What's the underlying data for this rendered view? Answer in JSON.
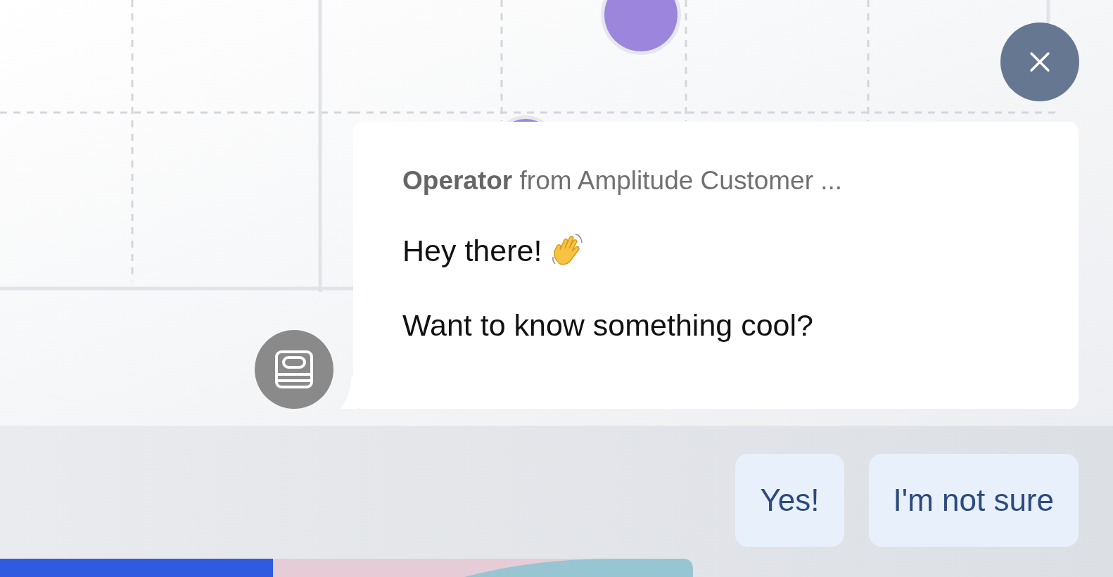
{
  "chat": {
    "sender": "**Operator** from Amplitude Customer ...",
    "messages": [
      {
        "text": "Hey there!",
        "has_icon": true
      },
      {
        "text": "Want to know something cool?",
        "has_icon": false
      }
    ]
  },
  "replies": [
    "Yes!",
    "I'm not sure"
  ]
}
